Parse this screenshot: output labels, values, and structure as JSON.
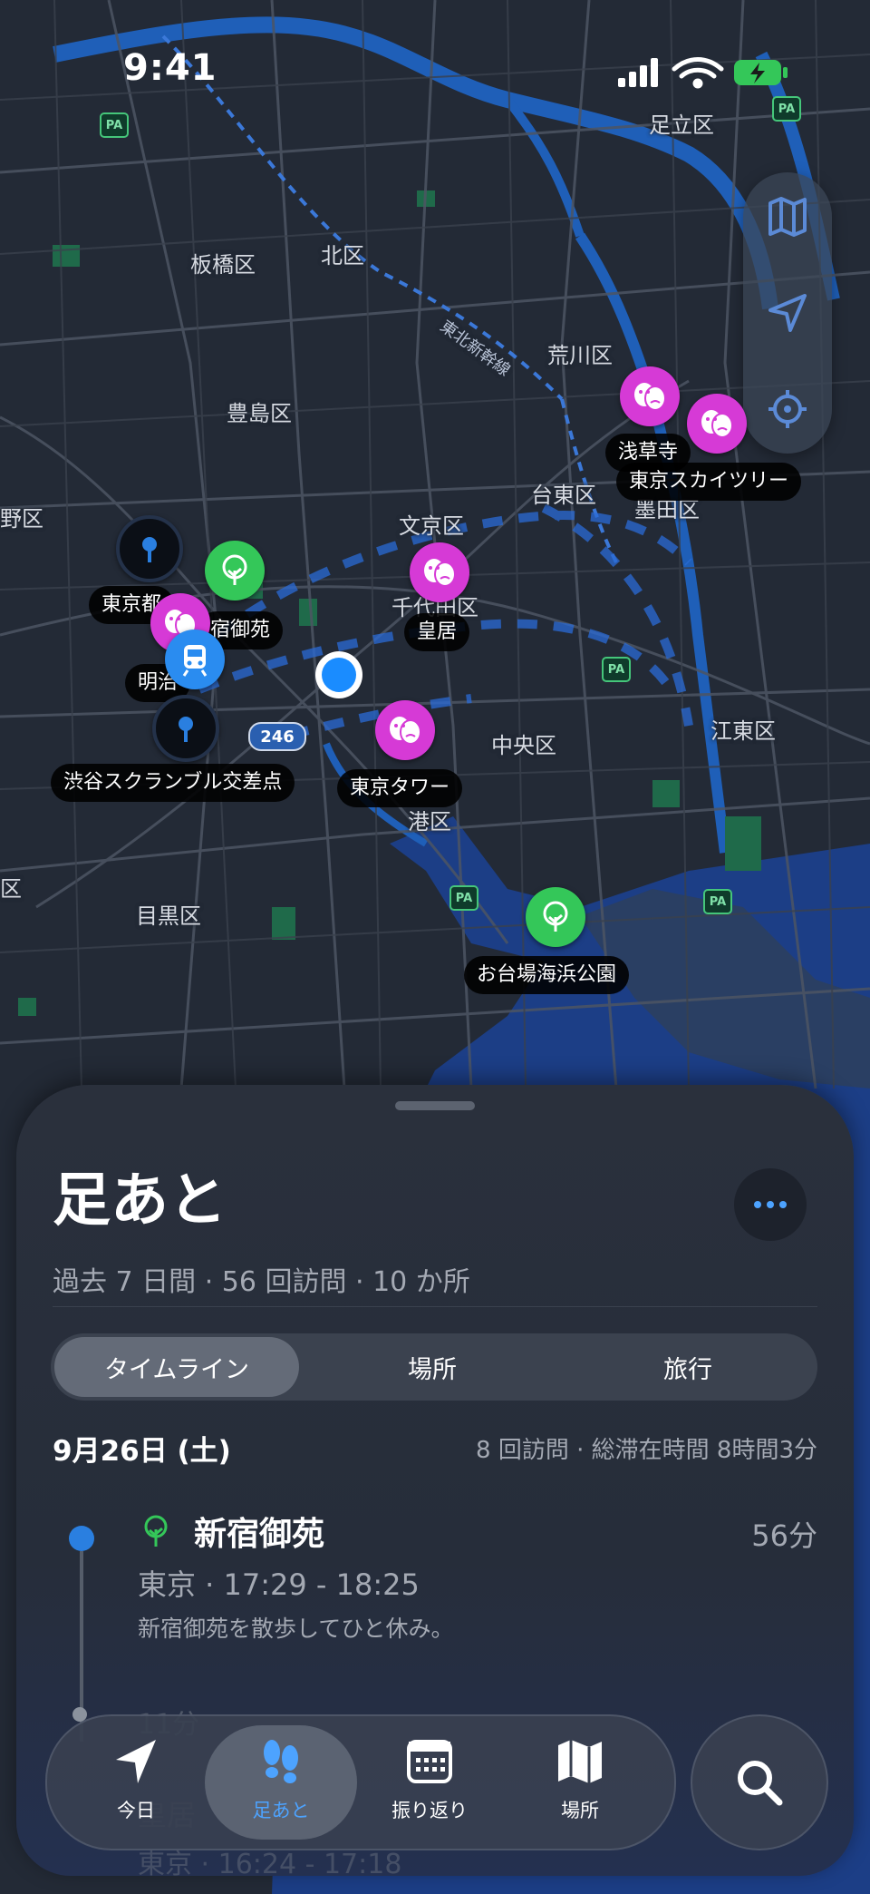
{
  "status_bar": {
    "time": "9:41"
  },
  "map": {
    "area_labels": [
      "足立区",
      "板橋区",
      "北区",
      "荒川区",
      "豊島区",
      "文京区",
      "台東区",
      "墨田区",
      "野区",
      "千代田区",
      "中央区",
      "江東区",
      "港区",
      "目黒区",
      "区"
    ],
    "rail_label": "東北新幹線",
    "route_shield": "246",
    "pa_badge": "PA",
    "pins": [
      {
        "name": "浅草寺",
        "category": "theater-masks-icon"
      },
      {
        "name": "東京スカイツリー",
        "category": "theater-masks-icon"
      },
      {
        "name": "東京都",
        "category": "pin-icon"
      },
      {
        "name": "新宿御苑",
        "category": "tree-icon"
      },
      {
        "name": "皇居",
        "category": "theater-masks-icon"
      },
      {
        "name": "明治神宮",
        "category": "train-icon"
      },
      {
        "name": "渋谷スクランブル交差点",
        "category": "pin-icon"
      },
      {
        "name": "東京タワー",
        "category": "theater-masks-icon"
      },
      {
        "name": "お台場海浜公園",
        "category": "tree-icon"
      }
    ],
    "pin_label_fragments": {
      "tokyo_to": "東京都",
      "shinjuku_partial": "宿御苑",
      "meiji_partial": "明治",
      "tosho_partial": "千"
    },
    "colors": {
      "theater": "#d63ad6",
      "park": "#34c759",
      "pin": "#0d5fa8",
      "train": "#2a8cf0",
      "user_location": "#1a8cff"
    }
  },
  "sheet": {
    "title": "足あと",
    "summary": "過去 7 日間 · 56 回訪問 · 10 か所",
    "segments": [
      "タイムライン",
      "場所",
      "旅行"
    ],
    "selected_segment": "タイムライン",
    "day": {
      "date": "9月26日 (土)",
      "stats": "8 回訪問 · 総滞在時間 8時間3分",
      "visits": [
        {
          "name": "新宿御苑",
          "duration": "56分",
          "meta": "東京 · 17:29 - 18:25",
          "note": "新宿御苑を散歩してひと休み。",
          "icon": "tree-icon"
        }
      ],
      "partial_next": {
        "gap": "11分",
        "name": "皇居",
        "meta": "東京 · 16:24 - 17:18"
      }
    }
  },
  "tab_bar": {
    "items": [
      {
        "label": "今日",
        "icon": "location-arrow-icon"
      },
      {
        "label": "足あと",
        "icon": "footprints-icon"
      },
      {
        "label": "振り返り",
        "icon": "calendar-icon"
      },
      {
        "label": "場所",
        "icon": "map-icon"
      }
    ],
    "selected": "足あと",
    "accent": "#4da3ff"
  }
}
